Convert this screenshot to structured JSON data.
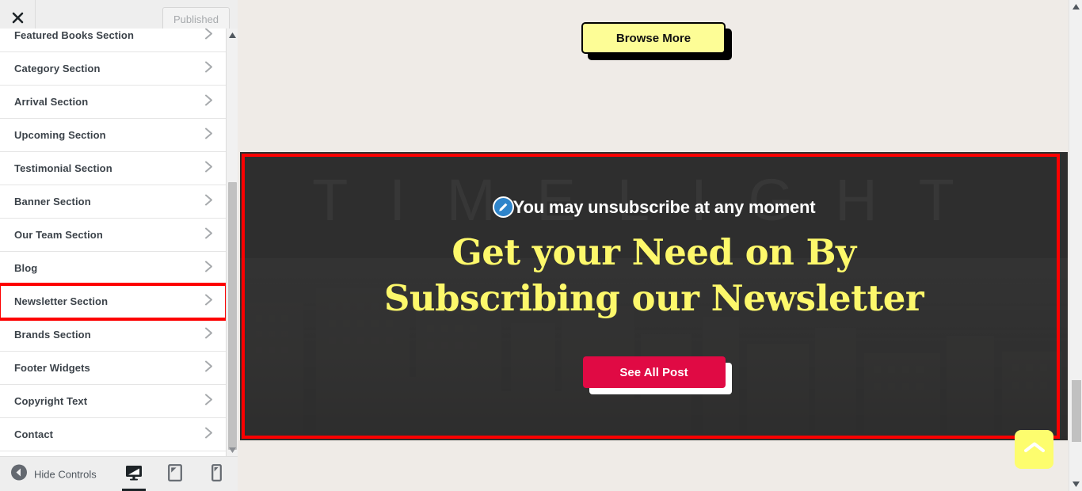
{
  "customizer": {
    "close_icon": "close-icon",
    "publish_label": "Published",
    "hide_controls_label": "Hide Controls",
    "collapse_icon": "collapse-left-icon",
    "sections": [
      {
        "label": "Featured Books Section",
        "chevron": "chevron-right-icon",
        "highlighted": false
      },
      {
        "label": "Category Section",
        "chevron": "chevron-right-icon",
        "highlighted": false
      },
      {
        "label": "Arrival Section",
        "chevron": "chevron-right-icon",
        "highlighted": false
      },
      {
        "label": "Upcoming Section",
        "chevron": "chevron-right-icon",
        "highlighted": false
      },
      {
        "label": "Testimonial Section",
        "chevron": "chevron-right-icon",
        "highlighted": false
      },
      {
        "label": "Banner Section",
        "chevron": "chevron-right-icon",
        "highlighted": false
      },
      {
        "label": "Our Team Section",
        "chevron": "chevron-right-icon",
        "highlighted": false
      },
      {
        "label": "Blog",
        "chevron": "chevron-right-icon",
        "highlighted": false
      },
      {
        "label": "Newsletter Section",
        "chevron": "chevron-right-icon",
        "highlighted": true
      },
      {
        "label": "Brands Section",
        "chevron": "chevron-right-icon",
        "highlighted": false
      },
      {
        "label": "Footer Widgets",
        "chevron": "chevron-right-icon",
        "highlighted": false
      },
      {
        "label": "Copyright Text",
        "chevron": "chevron-right-icon",
        "highlighted": false
      },
      {
        "label": "Contact",
        "chevron": "chevron-right-icon",
        "highlighted": false
      }
    ],
    "devices": [
      {
        "name": "desktop",
        "icon": "desktop-icon",
        "active": true
      },
      {
        "name": "tablet",
        "icon": "tablet-icon",
        "active": false
      },
      {
        "name": "mobile",
        "icon": "mobile-icon",
        "active": false
      }
    ]
  },
  "preview": {
    "browse_more_label": "Browse More",
    "newsletter": {
      "edit_icon": "pencil-edit-icon",
      "subtitle": "You may unsubscribe at any moment",
      "title": "Get your Need on By Subscribing our Newsletter",
      "cta_label": "See All Post",
      "watermark_text": "TIMELIGHT",
      "background": "city-skyline-image"
    },
    "back_to_top_icon": "chevron-up-icon"
  },
  "colors": {
    "highlight_outline": "#fd0000",
    "page_background": "#efebe7",
    "newsletter_background": "#2e2e2e",
    "title_yellow": "#fdf86b",
    "cta_crimson": "#e00a44",
    "browse_yellow": "#fdfd96",
    "back_to_top_yellow": "#fdfd6e",
    "edit_badge_blue": "#2e84ca"
  }
}
